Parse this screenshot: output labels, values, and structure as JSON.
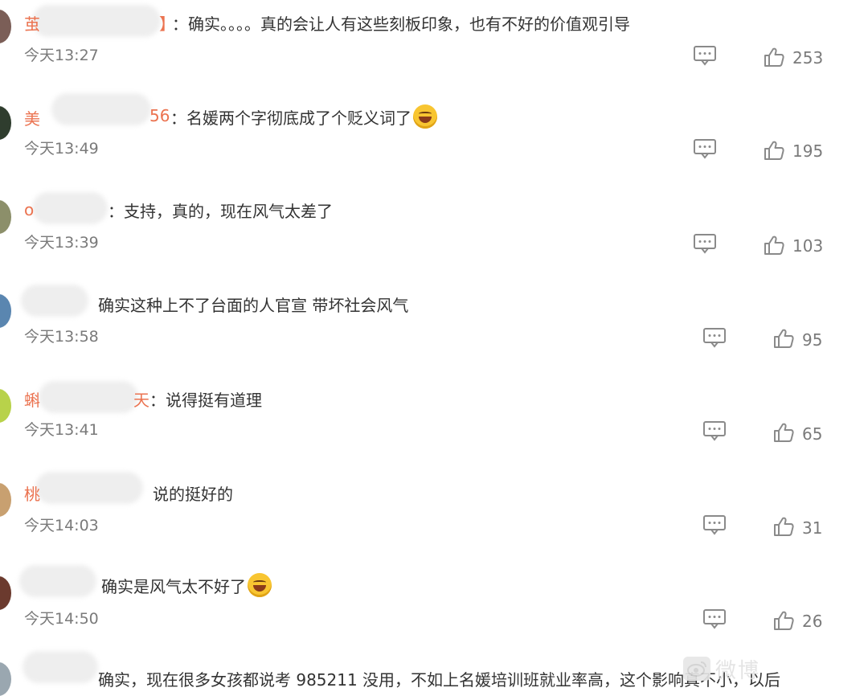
{
  "comments": [
    {
      "name_prefix": "茧",
      "name_suffix": "】",
      "text": "：确实。。。。真的会让人有这些刻板印象，也有不好的价值观引导",
      "time": "今天13:27",
      "likes": "253",
      "avatar_color": "#7b5e57",
      "emoji": ""
    },
    {
      "name_prefix": "美",
      "name_suffix": "56",
      "text": "：名媛两个字彻底成了个贬义词了",
      "time": "今天13:49",
      "likes": "195",
      "avatar_color": "#2f3d2e",
      "emoji": "cry-laugh-emoji"
    },
    {
      "name_prefix": "o",
      "name_suffix": "",
      "text": "：支持，真的，现在风气太差了",
      "time": "今天13:39",
      "likes": "103",
      "avatar_color": "#8c8f6a",
      "emoji": ""
    },
    {
      "name_prefix": "",
      "name_suffix": "",
      "text": "确实这种上不了台面的人官宣 带坏社会风气",
      "time": "今天13:58",
      "likes": "95",
      "avatar_color": "#5a86b0",
      "emoji": ""
    },
    {
      "name_prefix": "蝌",
      "name_suffix": "天",
      "text": "：说得挺有道理",
      "time": "今天13:41",
      "likes": "65",
      "avatar_color": "#b8d24a",
      "emoji": ""
    },
    {
      "name_prefix": "桃",
      "name_suffix": "",
      "text": "说的挺好的",
      "time": "今天14:03",
      "likes": "31",
      "avatar_color": "#c8a070",
      "emoji": ""
    },
    {
      "name_prefix": "",
      "name_suffix": "",
      "text": "确实是风气太不好了",
      "time": "今天14:50",
      "likes": "26",
      "avatar_color": "#6b3a2e",
      "emoji": "laugh-emoji"
    },
    {
      "name_prefix": "",
      "name_suffix": "",
      "text": "确实，现在很多女孩都说考 985211 没用，不如上名媛培训班就业率高，这个影响真不小，以后",
      "time": "",
      "likes": "",
      "avatar_color": "#9aa7b0",
      "emoji": ""
    }
  ],
  "colors": {
    "name": "#eb7350",
    "text": "#333333",
    "meta": "#7a7a7a",
    "icon": "#8a8a8a"
  },
  "icons": {
    "reply": "comment-icon",
    "like": "thumbs-up-icon"
  },
  "watermark": {
    "text": "微博"
  }
}
